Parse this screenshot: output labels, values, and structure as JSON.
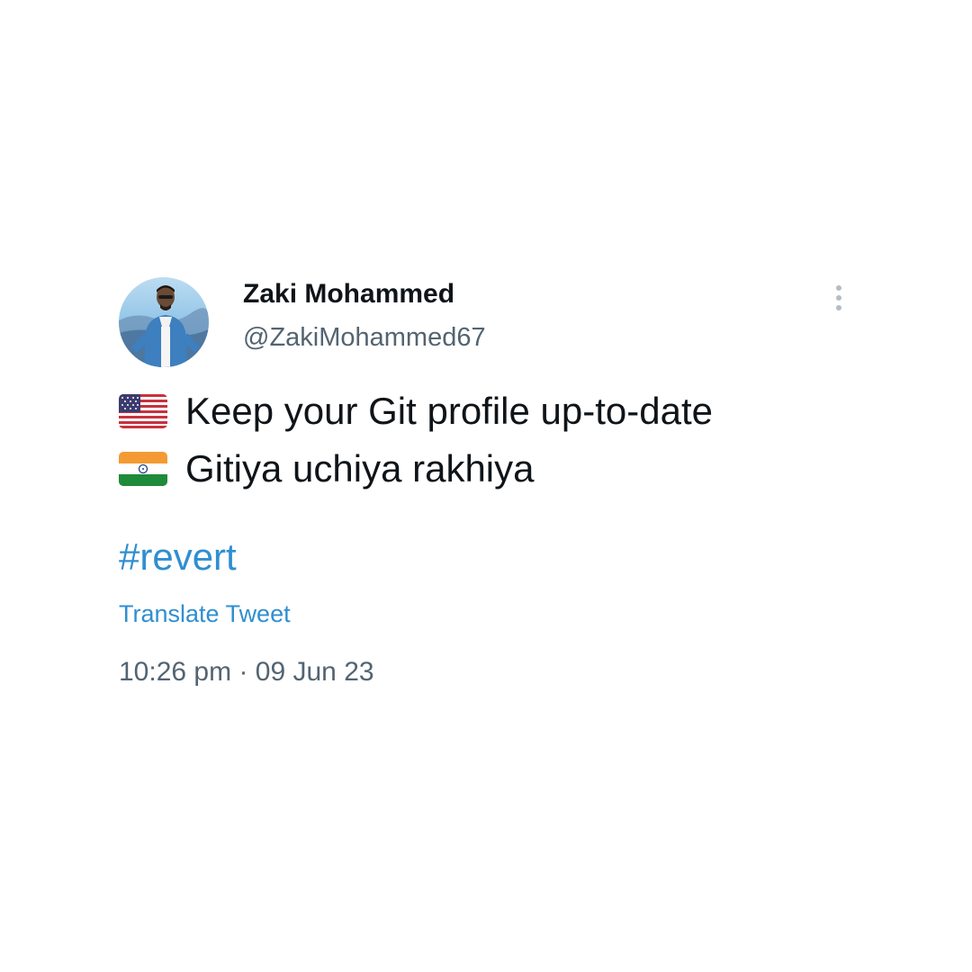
{
  "tweet": {
    "author": {
      "display_name": "Zaki Mohammed",
      "handle": "@ZakiMohammed67"
    },
    "more_icon": "more-vertical-icon",
    "lines": [
      {
        "flag_icon": "us-flag-icon",
        "text": "Keep your Git profile up-to-date"
      },
      {
        "flag_icon": "india-flag-icon",
        "text": "Gitiya uchiya rakhiya"
      }
    ],
    "hashtag": "#revert",
    "translate_label": "Translate Tweet",
    "time": "10:26 pm",
    "separator": "·",
    "date": "09 Jun 23"
  },
  "colors": {
    "text_primary": "#0f1419",
    "text_secondary": "#536471",
    "link": "#2f8fd0",
    "background": "#ffffff"
  }
}
